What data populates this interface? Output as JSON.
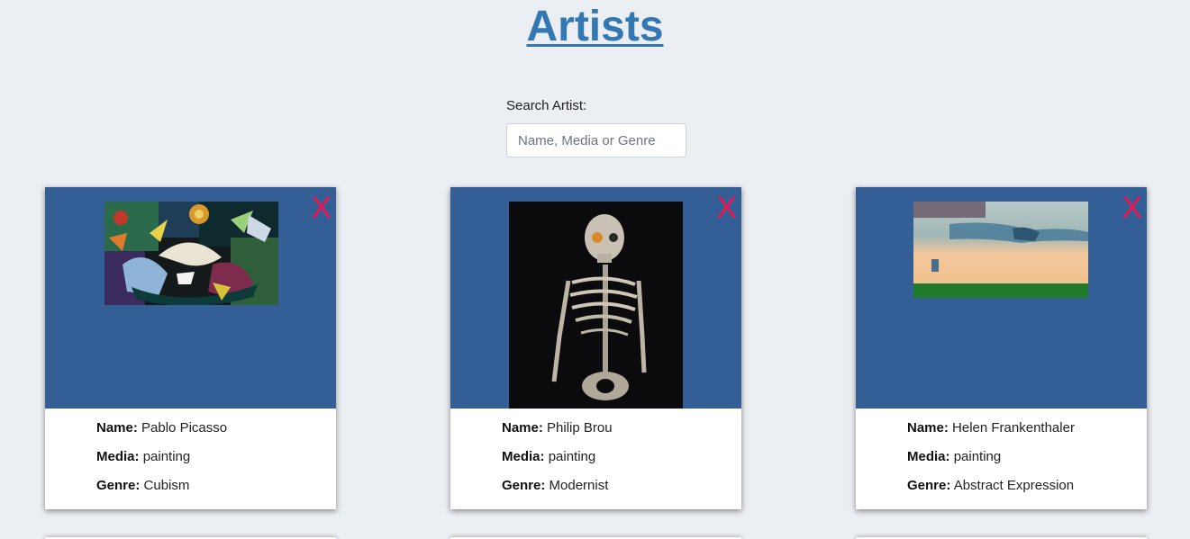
{
  "header": {
    "title": "Artists"
  },
  "search": {
    "label": "Search Artist:",
    "placeholder": "Name, Media or Genre",
    "value": ""
  },
  "card_labels": {
    "name": "Name:",
    "media": "Media:",
    "genre": "Genre:",
    "close": "X"
  },
  "artists": [
    {
      "name": "Pablo Picasso",
      "media": "painting",
      "genre": "Cubism"
    },
    {
      "name": "Philip Brou",
      "media": "painting",
      "genre": "Modernist"
    },
    {
      "name": "Helen Frankenthaler",
      "media": "painting",
      "genre": "Abstract Expression"
    }
  ],
  "colors": {
    "title": "#3378b2",
    "card_image_bg": "#345f96",
    "close": "#f0144e",
    "page_bg": "#ebeef2"
  }
}
